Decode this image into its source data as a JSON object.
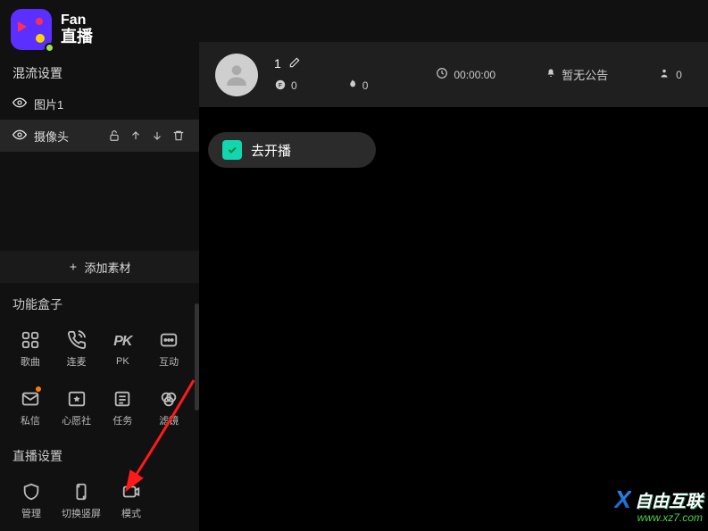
{
  "logo": {
    "line1": "Fan",
    "line2": "直播"
  },
  "mix": {
    "title": "混流设置",
    "sources": [
      {
        "name": "图片1"
      },
      {
        "name": "摄像头"
      }
    ],
    "add": "添加素材"
  },
  "funcbox": {
    "title": "功能盒子",
    "items": [
      {
        "label": "歌曲"
      },
      {
        "label": "连麦"
      },
      {
        "label": "PK"
      },
      {
        "label": "互动"
      },
      {
        "label": "私信"
      },
      {
        "label": "心愿社"
      },
      {
        "label": "任务"
      },
      {
        "label": "滤镜"
      }
    ]
  },
  "livecfg": {
    "title": "直播设置",
    "items": [
      {
        "label": "管理"
      },
      {
        "label": "切换竖屏"
      },
      {
        "label": "模式"
      }
    ]
  },
  "top": {
    "id": "1",
    "coin": "0",
    "fire": "0",
    "timer": "00:00:00",
    "announce": "暂无公告",
    "people": "0"
  },
  "golive": "去开播",
  "watermark": {
    "brand": "自由互联",
    "url": "www.xz7.com"
  }
}
